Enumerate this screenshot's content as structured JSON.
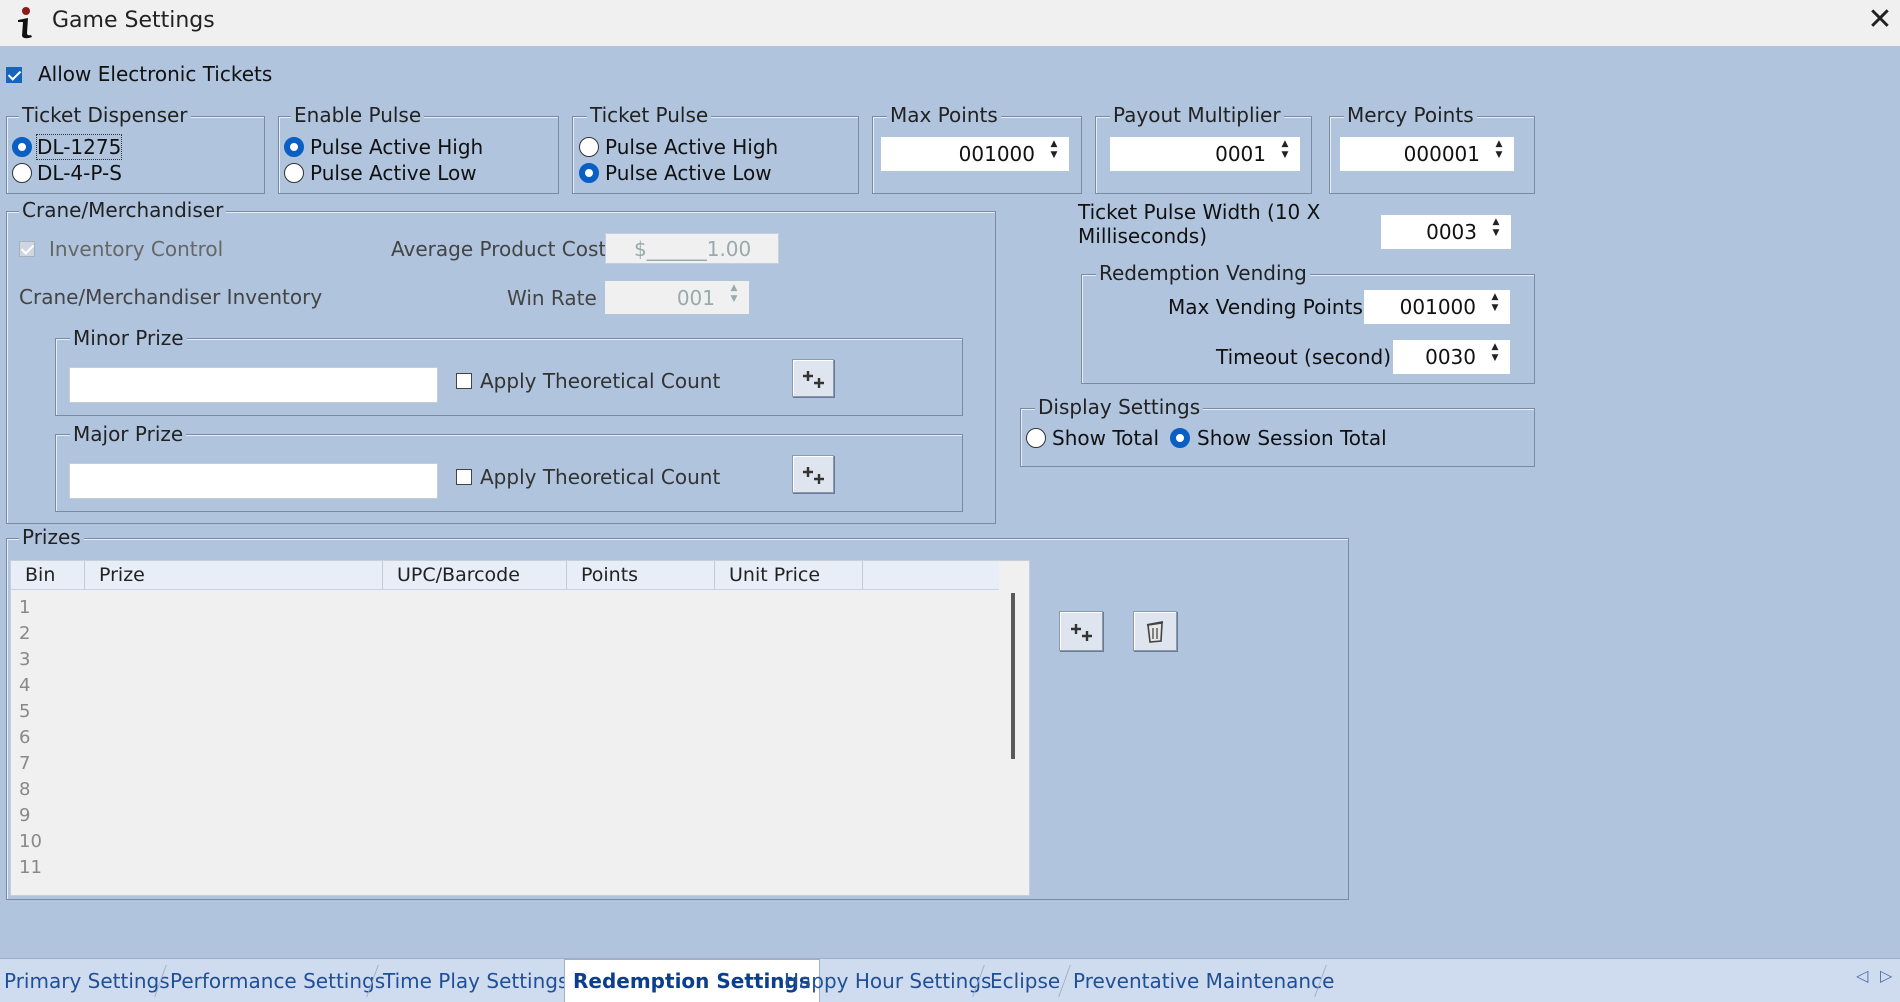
{
  "window": {
    "title": "Game Settings"
  },
  "allow_electronic_tickets": {
    "label": "Allow Electronic Tickets",
    "checked": true
  },
  "ticket_dispenser": {
    "legend": "Ticket Dispenser",
    "options": [
      "DL-1275",
      "DL-4-P-S"
    ],
    "selected": "DL-1275"
  },
  "enable_pulse": {
    "legend": "Enable Pulse",
    "options": [
      "Pulse Active High",
      "Pulse Active Low"
    ],
    "selected": "Pulse Active High"
  },
  "ticket_pulse": {
    "legend": "Ticket Pulse",
    "options": [
      "Pulse Active High",
      "Pulse Active Low"
    ],
    "selected": "Pulse Active Low"
  },
  "max_points": {
    "legend": "Max Points",
    "value": "001000"
  },
  "payout_multiplier": {
    "legend": "Payout Multiplier",
    "value": "0001"
  },
  "mercy_points": {
    "legend": "Mercy Points",
    "value": "000001"
  },
  "crane": {
    "legend": "Crane/Merchandiser",
    "inventory_control": "Inventory Control",
    "average_product_cost_label": "Average Product Cost",
    "average_product_cost_value": "$______1.00",
    "inventory_label": "Crane/Merchandiser Inventory",
    "win_rate_label": "Win Rate",
    "win_rate_value": "001",
    "minor_prize": {
      "legend": "Minor Prize",
      "value": "",
      "apply_label": "Apply Theoretical Count"
    },
    "major_prize": {
      "legend": "Major Prize",
      "value": "",
      "apply_label": "Apply Theoretical Count"
    }
  },
  "ticket_pulse_width": {
    "label_line1": "Ticket Pulse Width (10 X",
    "label_line2": "Milliseconds)",
    "value": "0003"
  },
  "redemption_vending": {
    "legend": "Redemption Vending",
    "max_vending_points_label": "Max Vending Points",
    "max_vending_points_value": "001000",
    "timeout_label": "Timeout (second)",
    "timeout_value": "0030"
  },
  "display_settings": {
    "legend": "Display Settings",
    "options": [
      "Show Total",
      "Show Session Total"
    ],
    "selected": "Show Session Total"
  },
  "prizes": {
    "legend": "Prizes",
    "columns": [
      "Bin",
      "Prize",
      "UPC/Barcode",
      "Points",
      "Unit Price"
    ],
    "rows": [
      "1",
      "2",
      "3",
      "4",
      "5",
      "6",
      "7",
      "8",
      "9",
      "10",
      "11"
    ]
  },
  "icons": {
    "add": "add-icon",
    "delete": "trash-icon"
  },
  "tabs": [
    "Primary Settings",
    "Performance Settings",
    "Time Play Settings",
    "Redemption Settings",
    "Happy Hour Settings",
    "Eclipse",
    "Preventative Maintenance"
  ],
  "active_tab": "Redemption Settings",
  "colors": {
    "background": "#b0c4de",
    "accent": "#0a5fc4",
    "tab_text": "#1f4f96"
  }
}
